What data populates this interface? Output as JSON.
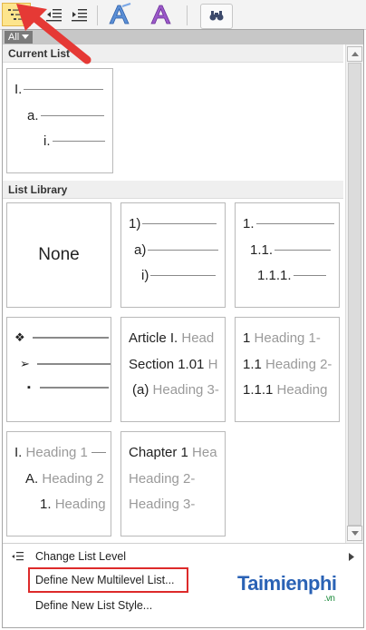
{
  "toolbar": {
    "icons": [
      "multilevel-list-icon",
      "decrease-indent-icon",
      "increase-indent-icon",
      "text-effects-icon",
      "styles-icon",
      "find-icon"
    ]
  },
  "filter": {
    "label": "All"
  },
  "sections": {
    "current": "Current List",
    "library": "List Library"
  },
  "current_list": {
    "levels": [
      "I.",
      "a.",
      "i."
    ]
  },
  "library": {
    "none": "None",
    "numbered": [
      "1)",
      "a)",
      "i)"
    ],
    "decimal": [
      "1.",
      "1.1.",
      "1.1.1."
    ],
    "bullets": [
      "❖",
      "➢",
      "▪"
    ],
    "article": [
      {
        "label": "Article I.",
        "text": "Head"
      },
      {
        "label": "Section 1.01",
        "text": "H"
      },
      {
        "label": "(a)",
        "text": "Heading 3-"
      }
    ],
    "heading_num": [
      {
        "label": "1",
        "text": "Heading 1-"
      },
      {
        "label": "1.1",
        "text": "Heading 2-"
      },
      {
        "label": "1.1.1",
        "text": "Heading"
      }
    ],
    "heading_roman": [
      {
        "label": "I.",
        "text": "Heading 1"
      },
      {
        "label": "A.",
        "text": "Heading 2"
      },
      {
        "label": "1.",
        "text": "Heading"
      }
    ],
    "chapter": [
      {
        "label": "Chapter 1",
        "text": "Hea"
      },
      {
        "label": "",
        "text": "Heading 2-"
      },
      {
        "label": "",
        "text": "Heading 3-"
      }
    ]
  },
  "menu": {
    "change_level": "Change List Level",
    "define_multilevel": "Define New Multilevel List...",
    "define_style": "Define New List Style..."
  },
  "watermark": {
    "brand": "Taimienphi",
    "suffix": ".vn"
  },
  "colors": {
    "accent": "#dd2a2a",
    "highlight": "#fde58d",
    "brand": "#2a62b5"
  }
}
